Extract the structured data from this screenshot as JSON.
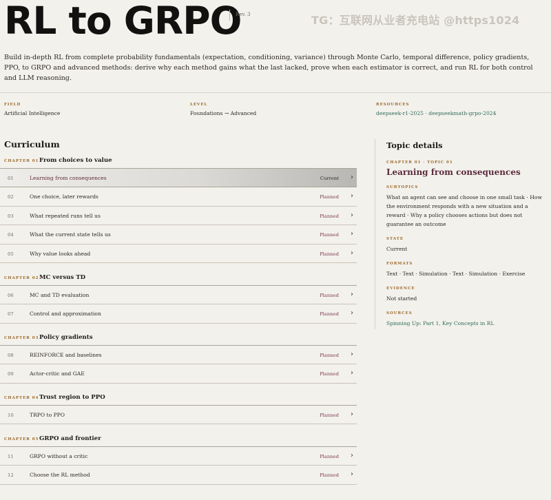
{
  "header": {
    "title": "RL to GRPO",
    "revision": "Rev. 3",
    "watermark": "TG：互联网从业者充电站 @https1024"
  },
  "description": "Build in-depth RL from complete probability fundamentals (expectation, conditioning, variance) through Monte Carlo, temporal difference, policy gradients, PPO, to GRPO and advanced methods: derive why each method gains what the last lacked, prove when each estimator is correct, and run RL for both control and LLM reasoning.",
  "meta": {
    "field_label": "FIELD",
    "field_value": "Artificial Intelligence",
    "level_label": "LEVEL",
    "level_value": "Foundations → Advanced",
    "resources_label": "RESOURCES",
    "resources_value": "deepseek-r1-2025 · deepseekmath-grpo-2024"
  },
  "curriculum": {
    "heading": "Curriculum",
    "chapters": [
      {
        "number": "CHAPTER 01",
        "title": "From choices to value",
        "topics": [
          {
            "num": "01",
            "title": "Learning from consequences",
            "status": "Current",
            "active": true
          },
          {
            "num": "02",
            "title": "One choice, later rewards",
            "status": "Planned"
          },
          {
            "num": "03",
            "title": "What repeated runs tell us",
            "status": "Planned"
          },
          {
            "num": "04",
            "title": "What the current state tells us",
            "status": "Planned"
          },
          {
            "num": "05",
            "title": "Why value looks ahead",
            "status": "Planned"
          }
        ]
      },
      {
        "number": "CHAPTER 02",
        "title": "MC versus TD",
        "topics": [
          {
            "num": "06",
            "title": "MC and TD evaluation",
            "status": "Planned"
          },
          {
            "num": "07",
            "title": "Control and approximation",
            "status": "Planned"
          }
        ]
      },
      {
        "number": "CHAPTER 03",
        "title": "Policy gradients",
        "topics": [
          {
            "num": "08",
            "title": "REINFORCE and baselines",
            "status": "Planned"
          },
          {
            "num": "09",
            "title": "Actor-critic and GAE",
            "status": "Planned"
          }
        ]
      },
      {
        "number": "CHAPTER 04",
        "title": "Trust region to PPO",
        "topics": [
          {
            "num": "10",
            "title": "TRPO to PPO",
            "status": "Planned"
          }
        ]
      },
      {
        "number": "CHAPTER 05",
        "title": "GRPO and frontier",
        "topics": [
          {
            "num": "11",
            "title": "GRPO without a critic",
            "status": "Planned"
          },
          {
            "num": "12",
            "title": "Choose the RL method",
            "status": "Planned"
          }
        ]
      }
    ]
  },
  "topic_details": {
    "heading": "Topic details",
    "crumb": "CHAPTER 01 · TOPIC 01",
    "topic_title": "Learning from consequences",
    "subtopics_label": "SUBTOPICS",
    "subtopics_value": "What an agent can see and choose in one small task · How the environment responds with a new situation and a reward · Why a policy chooses actions but does not guarantee an outcome",
    "state_label": "STATE",
    "state_value": "Current",
    "formats_label": "FORMATS",
    "formats_value": "Text · Text · Simulation · Text · Simulation · Exercise",
    "evidence_label": "EVIDENCE",
    "evidence_value": "Not started",
    "sources_label": "SOURCES",
    "sources_value": "Spinning Up: Part 1, Key Concepts in RL"
  }
}
